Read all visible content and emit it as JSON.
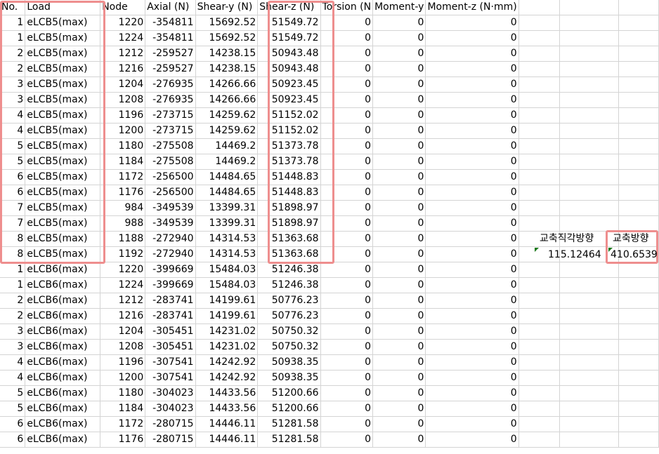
{
  "headers": [
    "No.",
    "Load",
    "Node",
    "Axial (N)",
    "Shear-y (N)",
    "Shear-z (N)",
    "Torsion (N",
    "Moment-y",
    "Moment-z (N·mm)"
  ],
  "rows": [
    [
      "1",
      "eLCB5(max)",
      "1220",
      "-354811",
      "15692.52",
      "51549.72",
      "0",
      "0",
      "0"
    ],
    [
      "1",
      "eLCB5(max)",
      "1224",
      "-354811",
      "15692.52",
      "51549.72",
      "0",
      "0",
      "0"
    ],
    [
      "2",
      "eLCB5(max)",
      "1212",
      "-259527",
      "14238.15",
      "50943.48",
      "0",
      "0",
      "0"
    ],
    [
      "2",
      "eLCB5(max)",
      "1216",
      "-259527",
      "14238.15",
      "50943.48",
      "0",
      "0",
      "0"
    ],
    [
      "3",
      "eLCB5(max)",
      "1204",
      "-276935",
      "14266.66",
      "50923.45",
      "0",
      "0",
      "0"
    ],
    [
      "3",
      "eLCB5(max)",
      "1208",
      "-276935",
      "14266.66",
      "50923.45",
      "0",
      "0",
      "0"
    ],
    [
      "4",
      "eLCB5(max)",
      "1196",
      "-273715",
      "14259.62",
      "51152.02",
      "0",
      "0",
      "0"
    ],
    [
      "4",
      "eLCB5(max)",
      "1200",
      "-273715",
      "14259.62",
      "51152.02",
      "0",
      "0",
      "0"
    ],
    [
      "5",
      "eLCB5(max)",
      "1180",
      "-275508",
      "14469.2",
      "51373.78",
      "0",
      "0",
      "0"
    ],
    [
      "5",
      "eLCB5(max)",
      "1184",
      "-275508",
      "14469.2",
      "51373.78",
      "0",
      "0",
      "0"
    ],
    [
      "6",
      "eLCB5(max)",
      "1172",
      "-256500",
      "14484.65",
      "51448.83",
      "0",
      "0",
      "0"
    ],
    [
      "6",
      "eLCB5(max)",
      "1176",
      "-256500",
      "14484.65",
      "51448.83",
      "0",
      "0",
      "0"
    ],
    [
      "7",
      "eLCB5(max)",
      "984",
      "-349539",
      "13399.31",
      "51898.97",
      "0",
      "0",
      "0"
    ],
    [
      "7",
      "eLCB5(max)",
      "988",
      "-349539",
      "13399.31",
      "51898.97",
      "0",
      "0",
      "0"
    ],
    [
      "8",
      "eLCB5(max)",
      "1188",
      "-272940",
      "14314.53",
      "51363.68",
      "0",
      "0",
      "0"
    ],
    [
      "8",
      "eLCB5(max)",
      "1192",
      "-272940",
      "14314.53",
      "51363.68",
      "0",
      "0",
      "0"
    ],
    [
      "1",
      "eLCB6(max)",
      "1220",
      "-399669",
      "15484.03",
      "51246.38",
      "0",
      "0",
      "0"
    ],
    [
      "1",
      "eLCB6(max)",
      "1224",
      "-399669",
      "15484.03",
      "51246.38",
      "0",
      "0",
      "0"
    ],
    [
      "2",
      "eLCB6(max)",
      "1212",
      "-283741",
      "14199.61",
      "50776.23",
      "0",
      "0",
      "0"
    ],
    [
      "2",
      "eLCB6(max)",
      "1216",
      "-283741",
      "14199.61",
      "50776.23",
      "0",
      "0",
      "0"
    ],
    [
      "3",
      "eLCB6(max)",
      "1204",
      "-305451",
      "14231.02",
      "50750.32",
      "0",
      "0",
      "0"
    ],
    [
      "3",
      "eLCB6(max)",
      "1208",
      "-305451",
      "14231.02",
      "50750.32",
      "0",
      "0",
      "0"
    ],
    [
      "4",
      "eLCB6(max)",
      "1196",
      "-307541",
      "14242.92",
      "50938.35",
      "0",
      "0",
      "0"
    ],
    [
      "4",
      "eLCB6(max)",
      "1200",
      "-307541",
      "14242.92",
      "50938.35",
      "0",
      "0",
      "0"
    ],
    [
      "5",
      "eLCB6(max)",
      "1180",
      "-304023",
      "14433.56",
      "51200.66",
      "0",
      "0",
      "0"
    ],
    [
      "5",
      "eLCB6(max)",
      "1184",
      "-304023",
      "14433.56",
      "51200.66",
      "0",
      "0",
      "0"
    ],
    [
      "6",
      "eLCB6(max)",
      "1172",
      "-280715",
      "14446.11",
      "51281.58",
      "0",
      "0",
      "0"
    ],
    [
      "6",
      "eLCB6(max)",
      "1176",
      "-280715",
      "14446.11",
      "51281.58",
      "0",
      "0",
      "0"
    ]
  ],
  "side": {
    "perp_label": "교축직각방향",
    "perp_value": "115.12464",
    "axial_label": "교축방향",
    "axial_value": "410.6539"
  },
  "colors": {
    "highlight": "#ee8e8e",
    "gridline": "#d4d4d4",
    "note_marker": "#1e7a1e"
  }
}
